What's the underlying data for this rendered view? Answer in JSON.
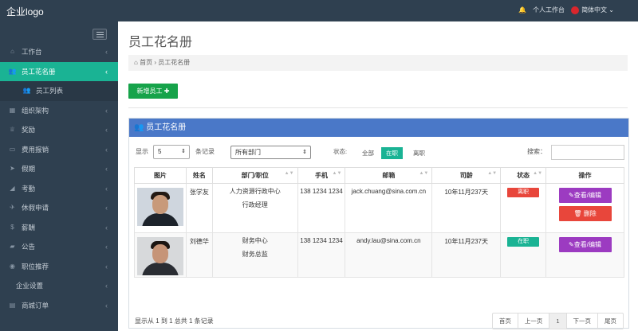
{
  "topbar": {
    "logo": "企业logo",
    "workbench": "个人工作台",
    "language": "简体中文",
    "lang_caret": "⌄",
    "colors": {
      "bar": "#2f4050",
      "accent": "#1ab394"
    }
  },
  "sidebar": {
    "items": [
      {
        "label": "工作台",
        "icon": "home-icon",
        "glyph": "⌂"
      },
      {
        "label": "员工花名册",
        "icon": "users-icon",
        "glyph": "👥",
        "active": true
      },
      {
        "label": "员工列表",
        "icon": "users-icon",
        "glyph": "👥",
        "sub": true
      },
      {
        "label": "组织架构",
        "icon": "org-icon",
        "glyph": "▦"
      },
      {
        "label": "奖励",
        "icon": "trophy-icon",
        "glyph": "♕"
      },
      {
        "label": "费用报销",
        "icon": "money-icon",
        "glyph": "▭"
      },
      {
        "label": "假期",
        "icon": "send-icon",
        "glyph": "➤"
      },
      {
        "label": "考勤",
        "icon": "bullhorn-icon",
        "glyph": "◢"
      },
      {
        "label": "休假申请",
        "icon": "plane-icon",
        "glyph": "✈"
      },
      {
        "label": "薪酬",
        "icon": "dollar-icon",
        "glyph": "$"
      },
      {
        "label": "公告",
        "icon": "comment-icon",
        "glyph": "▰"
      },
      {
        "label": "职位推荐",
        "icon": "globe-icon",
        "glyph": "◉"
      },
      {
        "label": "企业设置",
        "icon": "",
        "glyph": ""
      },
      {
        "label": "商城订单",
        "icon": "cart-icon",
        "glyph": "▤"
      }
    ]
  },
  "main": {
    "title": "员工花名册",
    "breadcrumb": {
      "home": "首页",
      "separator": "›",
      "current": "员工花名册"
    },
    "new_button": "新增员工 ✚",
    "panel_title": "员工花名册",
    "controls": {
      "show_label": "显示",
      "show_value": "5",
      "records_label": "条记录",
      "department_value": "所有部门",
      "status_label": "状态:",
      "status_all": "全部",
      "status_active": "在职",
      "status_left": "离职",
      "search_label": "搜索："
    },
    "table": {
      "headers": [
        "图片",
        "姓名",
        "部门/职位",
        "手机",
        "邮箱",
        "司龄",
        "状态",
        "操作"
      ],
      "rows": [
        {
          "name": "张学友",
          "department": "人力资源行政中心",
          "position": "行政经理",
          "phone": "138 1234 1234",
          "email": "jack.chuang@sina.com.cn",
          "tenure": "10年11月237天",
          "status": "离职",
          "status_color": "#e8463b",
          "actions": [
            "✎查看/编辑",
            "🗑 删除"
          ]
        },
        {
          "name": "刘德华",
          "department": "财务中心",
          "position": "财务总监",
          "phone": "138 1234 1234",
          "email": "andy.lau@sina.com.cn",
          "tenure": "10年11月237天",
          "status": "在职",
          "status_color": "#1ab394",
          "actions": [
            "✎查看/编辑"
          ]
        }
      ]
    },
    "footer": {
      "summary": "显示从 1 到 1 总共 1 条记录",
      "pager": [
        "首页",
        "上一页",
        "1",
        "下一页",
        "尾页"
      ]
    }
  }
}
